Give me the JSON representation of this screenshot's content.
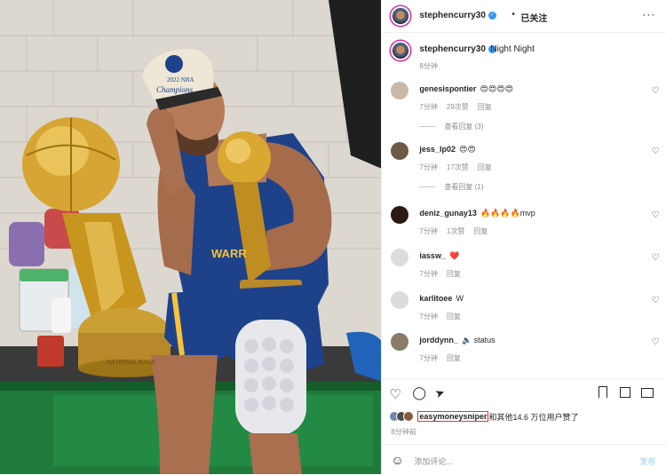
{
  "post": {
    "author": "stephencurry30",
    "follow_label": "已关注",
    "dot": "•",
    "more": "···",
    "caption": {
      "text": "Night Night",
      "time": "8分钟"
    },
    "photo_texts": {
      "cap_line1": "2022 NBA",
      "cap_line2": "Champions",
      "jersey": "WARR",
      "trophy_base": "NATIONAL BASK"
    }
  },
  "comments": [
    {
      "user": "genesispontier",
      "text": "😍😍😍😍",
      "time": "7分钟",
      "likes": "29次赞",
      "reply": "回复",
      "view_replies": "查看回复 (3)",
      "avatar_color": "#c9b8a8"
    },
    {
      "user": "jess_lp02",
      "text": "😍😍",
      "time": "7分钟",
      "likes": "17次赞",
      "reply": "回复",
      "view_replies": "查看回复 (1)",
      "avatar_color": "#6d5a45"
    },
    {
      "user": "deniz_gunay13",
      "text": "🔥🔥🔥🔥mvp",
      "time": "7分钟",
      "likes": "1次赞",
      "reply": "回复",
      "view_replies": "",
      "avatar_color": "#2b1a14"
    },
    {
      "user": "iassw_",
      "text": "❤️",
      "time": "7分钟",
      "likes": "",
      "reply": "回复",
      "view_replies": "",
      "avatar_color": "#dcdcdc"
    },
    {
      "user": "karlitoee",
      "text": "W",
      "time": "7分钟",
      "likes": "",
      "reply": "回复",
      "view_replies": "",
      "avatar_color": "#dcdcdc"
    },
    {
      "user": "jorddynn_",
      "text": "🔈 status",
      "time": "7分钟",
      "likes": "",
      "reply": "回复",
      "view_replies": "",
      "avatar_color": "#8a7a66"
    }
  ],
  "icons": {
    "heart": "♡",
    "comment": "◯",
    "share": "➤",
    "bookmark": "⌑",
    "emoji": "☺",
    "comment_heart": "♡",
    "verified": "✓"
  },
  "likes": {
    "first_user": "easymoneysniper",
    "rest": "和其他14.6 万位用户赞了"
  },
  "post_time": "8分钟前",
  "add_comment": {
    "placeholder": "添加评论...",
    "post": "发布"
  },
  "colors": {
    "accent": "#3897f0",
    "liked_border": "#e0392f",
    "muted": "#8e8e8e"
  }
}
